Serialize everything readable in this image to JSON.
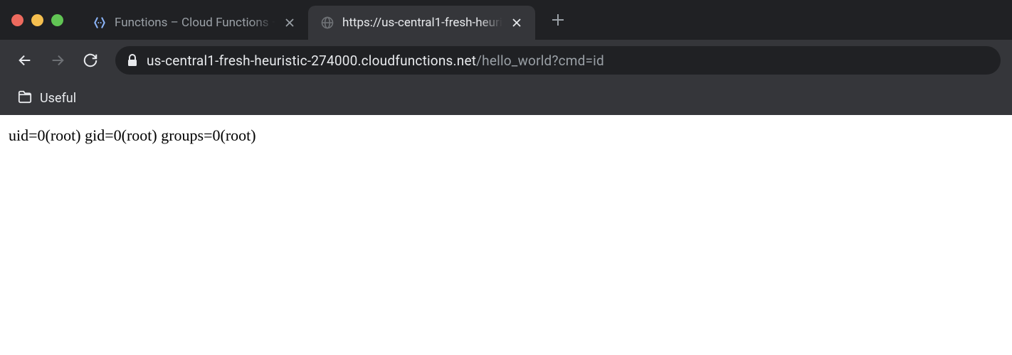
{
  "tabs": {
    "inactive": {
      "title": "Functions – Cloud Functions – "
    },
    "active": {
      "title": "https://us-central1-fresh-heuri"
    }
  },
  "addressBar": {
    "host": "us-central1-fresh-heuristic-274000.cloudfunctions.net",
    "path": "/hello_world?cmd=id"
  },
  "bookmarks": {
    "useful": "Useful"
  },
  "page": {
    "body": "uid=0(root) gid=0(root) groups=0(root)"
  }
}
